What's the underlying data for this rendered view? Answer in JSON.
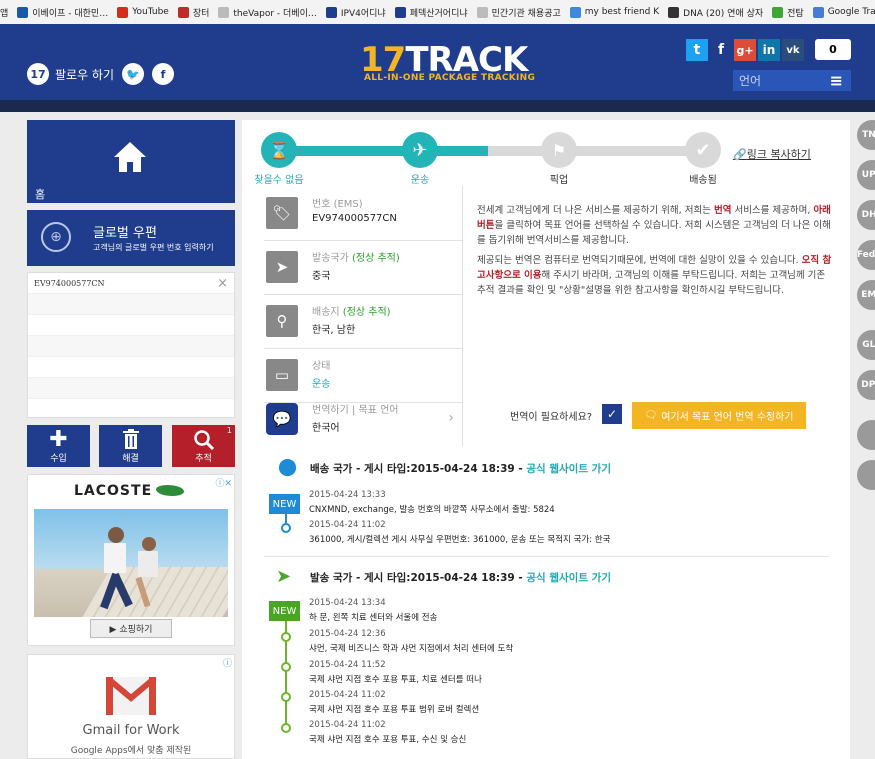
{
  "bookmarks": [
    {
      "label": "앱",
      "color": "#4a7bd4"
    },
    {
      "label": "이베이프 - 대한민…",
      "color": "#1c58a8"
    },
    {
      "label": "YouTube",
      "color": "#d62b1f"
    },
    {
      "label": "장터",
      "color": "#c02a2a"
    },
    {
      "label": "theVapor - 더베이…",
      "color": "#bbbbbb"
    },
    {
      "label": "IPV4어디냐",
      "color": "#1f3d8c"
    },
    {
      "label": "페덱산거어디냐",
      "color": "#1f3d8c"
    },
    {
      "label": "민간기관 채용공고",
      "color": "#bbbbbb"
    },
    {
      "label": "my best friend K",
      "color": "#3f8ad6"
    },
    {
      "label": "DNA (20) 연애 상자",
      "color": "#333333"
    },
    {
      "label": "전탐",
      "color": "#3ea537"
    },
    {
      "label": "Google Translate",
      "color": "#4a7bd4"
    }
  ],
  "header": {
    "logo_num": "17",
    "logo_text": "TRACK",
    "tagline": "ALL-IN-ONE PACKAGE TRACKING",
    "follow_label": "팔로우 하기",
    "share_count": "0",
    "language_label": "언어",
    "menu_icon": "≡"
  },
  "sidebar": {
    "home_label": "홈",
    "postal_title": "글로벌 우편",
    "postal_sub": "고객님의 글로벌 우편 번호 입력하기",
    "tracking_number": "EV974000577CN",
    "clear_icon": "×",
    "buttons": [
      {
        "label": "수입",
        "icon": "✚",
        "color": "#1f3d8c"
      },
      {
        "label": "해결",
        "icon": "🗑",
        "color": "#1f3d8c"
      },
      {
        "label": "추적",
        "icon": "⌕",
        "color": "#b3202a",
        "badge": "1"
      }
    ],
    "ad1": {
      "brand": "LACOSTE",
      "cta": "▶ 쇼핑하기"
    },
    "ad2": {
      "title": "Gmail for Work",
      "sub": "Google Apps에서 맞춤 제작된"
    }
  },
  "progress": {
    "steps": [
      {
        "label": "찾을수 없음",
        "active": true
      },
      {
        "label": "운송",
        "active": true
      },
      {
        "label": "픽업",
        "active": false
      },
      {
        "label": "배송됨",
        "active": false
      }
    ],
    "copy_link": "링크 복사하기"
  },
  "info": {
    "number_key": "번호 (EMS)",
    "number_val": "EV974000577CN",
    "origin_key": "발송국가",
    "origin_status": "(정상 추적)",
    "origin_val": "중국",
    "dest_key": "배송지",
    "dest_status": "(정상 추적)",
    "dest_val": "한국, 남한",
    "state_key": "상태",
    "state_val": "운송",
    "translate_key": "번역하기 | 목표 언어",
    "translate_val": "한국어"
  },
  "notice": {
    "p1_a": "전세계 고객님에게 더 나은 서비스를 제공하기 위해, 저희는 ",
    "p1_b": "번역",
    "p1_c": " 서비스를 제공하며, ",
    "p1_d": "아래 버튼",
    "p1_e": "을 클릭하여 목표 언어를 선택하실 수 있습니다. 저희 시스템은 고객님의 더 나은 이해를 돕기위해 번역서비스를 제공합니다.",
    "p2_a": "제공되는 번역은 컴퓨터로 번역되기때문에, 번역에 대한 실망이 있을 수 있습니다. ",
    "p2_b": "오직 참고사항으로 이용",
    "p2_c": "해 주시기 바라며, 고객님의 이해를 부탁드립니다. 저희는 고객님께 기존 추적 결과를 확인 및 \"상황\"설명을 위한 참고사항을 확인하시길 부탁드립니다.",
    "question": "번역이 필요하세요?",
    "modify_button": "여기서 목표 언어 번역 수정하기"
  },
  "destination": {
    "title_prefix": "배송 국가 - 게시 타입:",
    "date": "2015-04-24 18:39",
    "link": "공식 웹사이트 가기",
    "events": [
      {
        "time": "2015-04-24 13:33",
        "desc": "CNXMND, exchange, 발송 번호의 바깥쪽 사무소에서 출발: 5824",
        "new": true
      },
      {
        "time": "2015-04-24 11:02",
        "desc": "361000, 게시/컬렉션 게시 사무실 우편번호: 361000, 운송 또는 목적지 국가: 한국",
        "new": false
      }
    ]
  },
  "origin": {
    "title_prefix": "발송 국가 - 게시 타입:",
    "date": "2015-04-24 18:39",
    "link": "공식 웹사이트 가기",
    "events": [
      {
        "time": "2015-04-24 13:34",
        "desc": "하 문, 왼쪽 치료 센터와 서울에 전송",
        "new": true
      },
      {
        "time": "2015-04-24 12:36",
        "desc": "샤먼, 국제 비즈니스 학과 샤먼 지점에서 처리 센터에 도착",
        "new": false
      },
      {
        "time": "2015-04-24 11:52",
        "desc": "국제 샤먼 지점 호수 포용 투표, 치료 센터를 떠나",
        "new": false
      },
      {
        "time": "2015-04-24 11:02",
        "desc": "국제 샤먼 지점 호수 포용 투표 범위 로버 컬렉션",
        "new": false
      },
      {
        "time": "2015-04-24 11:02",
        "desc": "국제 샤먼 지점 호수 포용 투표, 수신 및 승신",
        "new": false
      }
    ],
    "new_label": "NEW"
  },
  "carriers": [
    "TNT",
    "UPS",
    "DHL",
    "Fedex",
    "EMS",
    "GLS",
    "DPD",
    "",
    ""
  ]
}
